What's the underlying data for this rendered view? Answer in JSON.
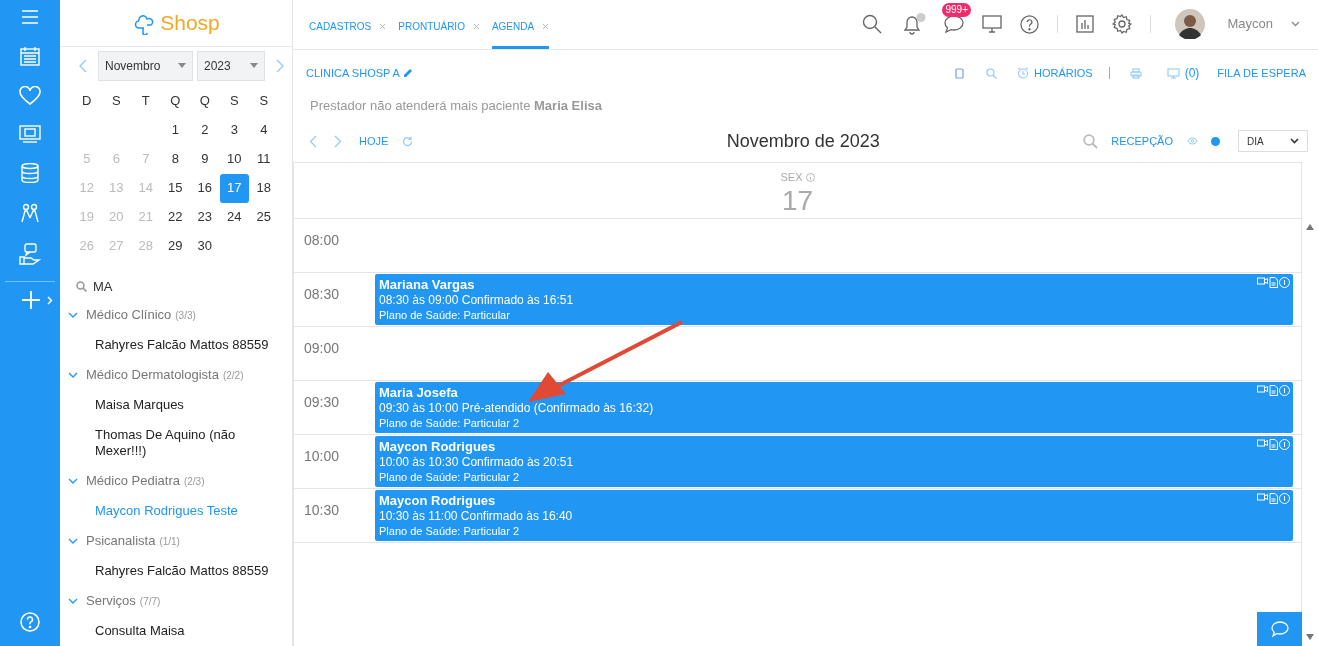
{
  "logo": {
    "text": "Shosp"
  },
  "mini_calendar": {
    "month": "Novembro",
    "year": "2023",
    "weekdays": [
      "D",
      "S",
      "T",
      "Q",
      "Q",
      "S",
      "S"
    ],
    "weeks": [
      {
        "kind": "leading",
        "days": [
          {
            "label": "1",
            "muted": false,
            "selected": false
          },
          {
            "label": "2",
            "muted": false,
            "selected": false
          },
          {
            "label": "3",
            "muted": false,
            "selected": false
          },
          {
            "label": "4",
            "muted": false,
            "selected": false
          }
        ]
      },
      {
        "kind": "week",
        "days": [
          {
            "label": "5",
            "muted": true,
            "selected": false
          },
          {
            "label": "6",
            "muted": true,
            "selected": false
          },
          {
            "label": "7",
            "muted": true,
            "selected": false
          },
          {
            "label": "8",
            "muted": false,
            "selected": false
          },
          {
            "label": "9",
            "muted": false,
            "selected": false
          },
          {
            "label": "10",
            "muted": false,
            "selected": false
          },
          {
            "label": "11",
            "muted": false,
            "selected": false
          }
        ]
      },
      {
        "kind": "week",
        "days": [
          {
            "label": "12",
            "muted": true,
            "selected": false
          },
          {
            "label": "13",
            "muted": true,
            "selected": false
          },
          {
            "label": "14",
            "muted": true,
            "selected": false
          },
          {
            "label": "15",
            "muted": false,
            "selected": false
          },
          {
            "label": "16",
            "muted": false,
            "selected": false
          },
          {
            "label": "17",
            "muted": false,
            "selected": true
          },
          {
            "label": "18",
            "muted": false,
            "selected": false
          }
        ]
      },
      {
        "kind": "week",
        "days": [
          {
            "label": "19",
            "muted": true,
            "selected": false
          },
          {
            "label": "20",
            "muted": true,
            "selected": false
          },
          {
            "label": "21",
            "muted": true,
            "selected": false
          },
          {
            "label": "22",
            "muted": false,
            "selected": false
          },
          {
            "label": "23",
            "muted": false,
            "selected": false
          },
          {
            "label": "24",
            "muted": false,
            "selected": false
          },
          {
            "label": "25",
            "muted": false,
            "selected": false
          }
        ]
      },
      {
        "kind": "week",
        "days": [
          {
            "label": "26",
            "muted": true,
            "selected": false
          },
          {
            "label": "27",
            "muted": true,
            "selected": false
          },
          {
            "label": "28",
            "muted": true,
            "selected": false
          },
          {
            "label": "29",
            "muted": false,
            "selected": false
          },
          {
            "label": "30",
            "muted": false,
            "selected": false
          }
        ]
      }
    ]
  },
  "provider_search": {
    "value": "MA"
  },
  "provider_groups": [
    {
      "name": "Médico Clínico",
      "count": "(3/3)",
      "expanded": true,
      "children": [
        {
          "label": "Rahyres Falcão Mattos 88559",
          "selected": false
        }
      ]
    },
    {
      "name": "Médico Dermatologista",
      "count": "(2/2)",
      "expanded": true,
      "children": [
        {
          "label": "Maisa Marques",
          "selected": false
        },
        {
          "label": "Thomas De Aquino (não Mexer!!!)",
          "selected": false
        }
      ]
    },
    {
      "name": "Médico Pediatra",
      "count": "(2/3)",
      "expanded": true,
      "children": [
        {
          "label": "Maycon Rodrigues Teste",
          "selected": true
        }
      ]
    },
    {
      "name": "Psicanalista",
      "count": "(1/1)",
      "expanded": true,
      "children": [
        {
          "label": "Rahyres Falcão Mattos 88559",
          "selected": false
        }
      ]
    },
    {
      "name": "Serviços",
      "count": "(7/7)",
      "expanded": true,
      "children": [
        {
          "label": "Consulta Maisa",
          "selected": false
        }
      ]
    }
  ],
  "tabs": [
    {
      "label": "CADASTROS",
      "selected": false
    },
    {
      "label": "PRONTUÁRIO",
      "selected": false
    },
    {
      "label": "AGENDA",
      "selected": true
    }
  ],
  "header": {
    "messages_badge": "999+",
    "user_name": "Maycon"
  },
  "clinic": "CLINICA SHOSP A",
  "toolbar": {
    "schedules": "HORÁRIOS",
    "monitor_count": "(0)",
    "waiting_list": "FILA DE ESPERA"
  },
  "notice": "Prestador não atenderá mais paciente **Maria Elisa**",
  "calendar": {
    "today": "HOJE",
    "title": "Novembro de 2023",
    "view_filter": "RECEPÇÃO",
    "view": "DIA",
    "day_header": {
      "weekday": "SEX",
      "day": "17"
    },
    "slots": [
      {
        "time": "08:00"
      },
      {
        "time": "08:30",
        "event": {
          "patient": "Mariana Vargas",
          "details": "08:30 às 09:00 Confirmado às 16:51",
          "plan": "Plano de Saúde: Particular"
        }
      },
      {
        "time": "09:00"
      },
      {
        "time": "09:30",
        "event": {
          "patient": "Maria Josefa",
          "details": "09:30 às 10:00 Pré-atendido (Confirmado às 16:32)",
          "plan": "Plano de Saúde: Particular 2"
        }
      },
      {
        "time": "10:00",
        "event": {
          "patient": "Maycon Rodrigues",
          "details": "10:00 às 10:30 Confirmado às 20:51",
          "plan": "Plano de Saúde: Particular 2"
        }
      },
      {
        "time": "10:30",
        "event": {
          "patient": "Maycon Rodrigues",
          "details": "10:30 às 11:00 Confirmado às 16:40",
          "plan": "Plano de Saúde: Particular 2"
        }
      }
    ]
  }
}
